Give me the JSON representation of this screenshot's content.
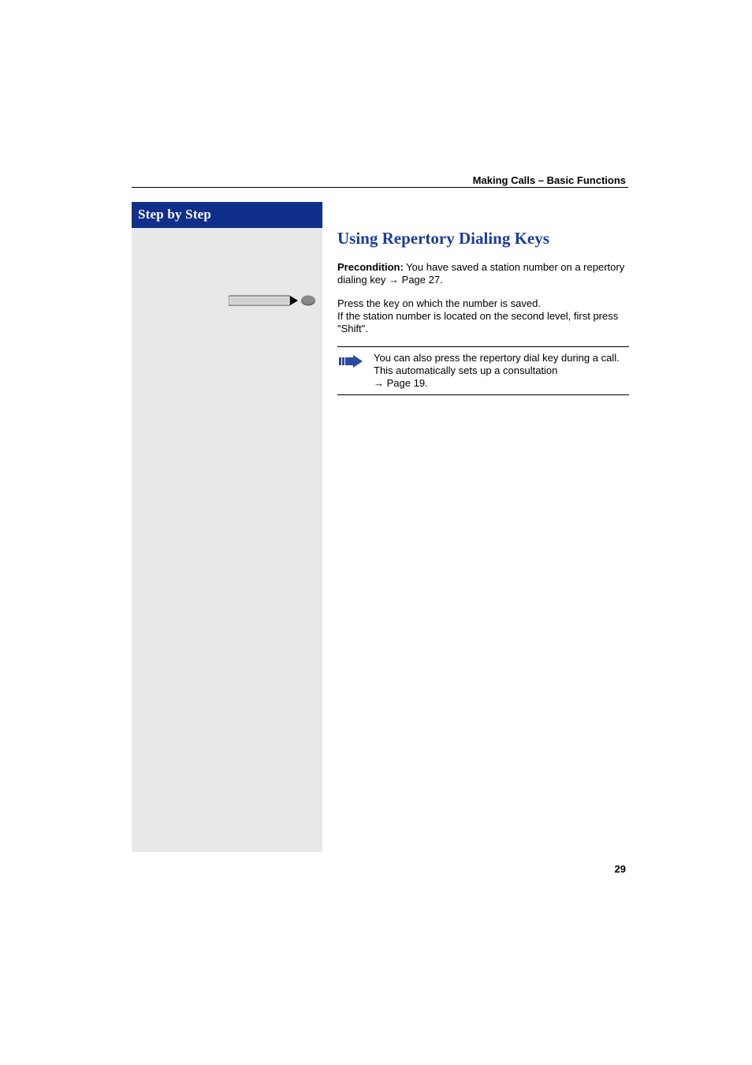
{
  "header": {
    "breadcrumb": "Making Calls – Basic Functions"
  },
  "sidebar": {
    "title": "Step by Step"
  },
  "content": {
    "section_title": "Using Repertory Dialing Keys",
    "precondition_label": "Precondition:",
    "precondition_text": " You have saved a station number on a repertory dialing key ",
    "precondition_ref": " Page 27.",
    "press_line1": "Press the key on which the number is saved.",
    "press_line2": "If the station number is located on the second level, first press \"Shift\".",
    "note_text": "You can also press the repertory dial key during a call. This automatically sets up a consultation ",
    "note_ref": " Page 19."
  },
  "page_number": "29"
}
